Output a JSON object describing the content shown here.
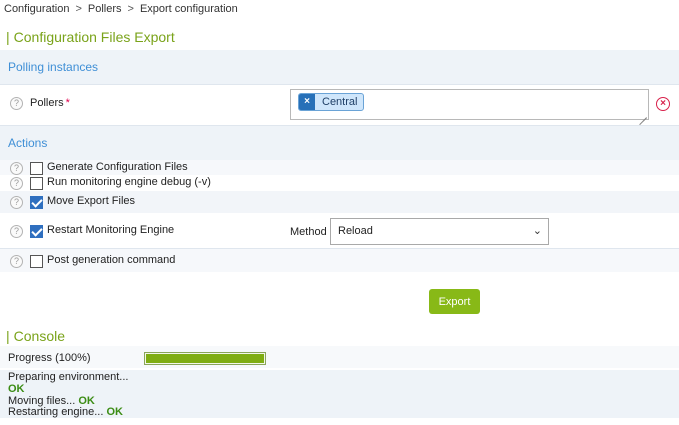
{
  "breadcrumb": {
    "items": [
      "Configuration",
      "Pollers",
      "Export configuration"
    ],
    "separator": ">"
  },
  "page_title": "Configuration Files Export",
  "polling": {
    "section_label": "Polling instances",
    "pollers_label": "Pollers",
    "required_mark": "*",
    "selected": [
      "Central"
    ],
    "remove_tag": "×",
    "clear_icon": "×"
  },
  "actions": {
    "section_label": "Actions",
    "items": [
      {
        "label": "Generate Configuration Files",
        "checked": false
      },
      {
        "label": "Run monitoring engine debug (-v)",
        "checked": false
      },
      {
        "label": "Move Export Files",
        "checked": true
      },
      {
        "label": "Restart Monitoring Engine",
        "checked": true
      },
      {
        "label": "Post generation command",
        "checked": false
      }
    ],
    "method_label": "Method",
    "method_value": "Reload",
    "export_button": "Export"
  },
  "console": {
    "title": "Console",
    "progress_label": "Progress",
    "progress_text": "(100%)",
    "progress_fraction": 1.0,
    "lines": {
      "preparing": "Preparing environment...",
      "preparing_ok": "OK",
      "moving": "Moving files...",
      "moving_ok": "OK",
      "restarting": "Restarting engine...",
      "restarting_ok": "OK"
    }
  },
  "help_glyph": "?",
  "colors": {
    "accent_green": "#88b917",
    "section_blue": "#3f8fd6",
    "ok_green": "#3b8c14",
    "required_red": "#e0004d"
  }
}
